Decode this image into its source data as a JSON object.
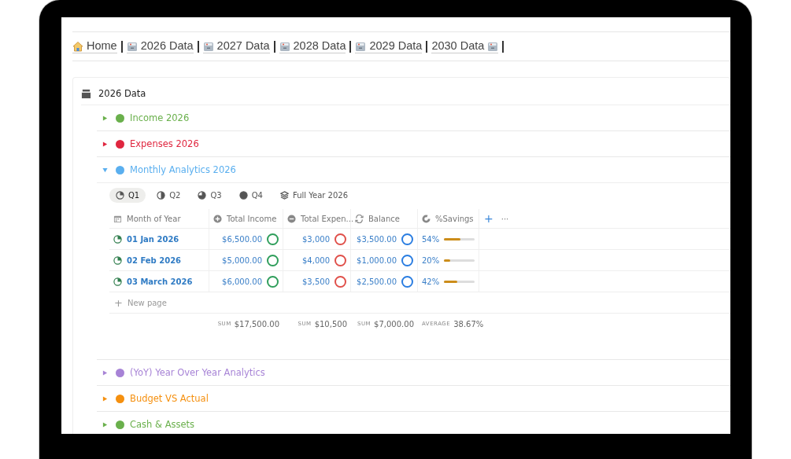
{
  "breadcrumb": [
    {
      "label": "Home",
      "kind": "home"
    },
    {
      "label": "2026 Data",
      "kind": "year"
    },
    {
      "label": "2027 Data",
      "kind": "year"
    },
    {
      "label": "2028 Data",
      "kind": "year"
    },
    {
      "label": "2029 Data",
      "kind": "year"
    },
    {
      "label": "2030 Data",
      "kind": "year_trailing"
    }
  ],
  "page": {
    "title": "2026 Data"
  },
  "sections": [
    {
      "label": "Income 2026",
      "color": "#6ab04c",
      "expanded": false
    },
    {
      "label": "Expenses 2026",
      "color": "#e0263f",
      "expanded": false
    },
    {
      "label": "Monthly Analytics 2026",
      "color": "#5aafef",
      "expanded": true
    },
    {
      "label": "(YoY) Year Over Year Analytics",
      "color": "#a783d6",
      "expanded": false
    },
    {
      "label": "Budget VS Actual",
      "color": "#f5900f",
      "expanded": false
    },
    {
      "label": "Cash & Assets",
      "color": "#6ab04c",
      "expanded": false
    }
  ],
  "view_tabs": [
    {
      "label": "Q1",
      "kind": "pie",
      "selected": true
    },
    {
      "label": "Q2",
      "kind": "pie",
      "selected": false
    },
    {
      "label": "Q3",
      "kind": "pie",
      "selected": false
    },
    {
      "label": "Q4",
      "kind": "pie",
      "selected": false
    },
    {
      "label": "Full Year 2026",
      "kind": "stack",
      "selected": false
    }
  ],
  "table": {
    "columns": [
      "Month of Year",
      "Total Income",
      "Total Expen...",
      "Balance",
      "%Savings"
    ],
    "rows": [
      {
        "month": "01 Jan 2026",
        "income": "$6,500.00",
        "expense": "$3,000",
        "balance": "$3,500.00",
        "savings": "54%",
        "level": 0.54
      },
      {
        "month": "02 Feb 2026",
        "income": "$5,000.00",
        "expense": "$4,000",
        "balance": "$1,000.00",
        "savings": "20%",
        "level": 0.2
      },
      {
        "month": "03 March 2026",
        "income": "$6,000.00",
        "expense": "$3,500",
        "balance": "$2,500.00",
        "savings": "42%",
        "level": 0.42
      }
    ],
    "add_row": "New page",
    "add_icon": "+",
    "more_icon": "···",
    "new_row_icon": "+",
    "footer": [
      {
        "kind": "SUM",
        "value": "$17,500.00"
      },
      {
        "kind": "SUM",
        "value": "$10,500"
      },
      {
        "kind": "SUM",
        "value": "$7,000.00"
      },
      {
        "kind": "AVERAGE",
        "value": "38.67%"
      }
    ]
  }
}
